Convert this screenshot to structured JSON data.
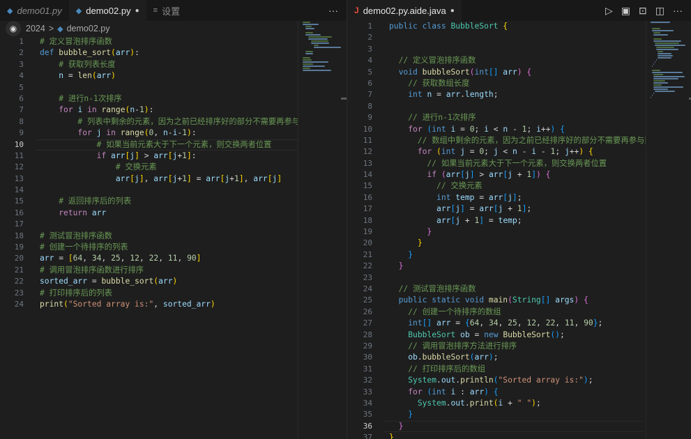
{
  "left": {
    "tabs": [
      {
        "label": "demo01.py",
        "italic": true,
        "active": false,
        "icon": "python-icon"
      },
      {
        "label": "demo02.py",
        "active": true,
        "dirty": true,
        "icon": "python-icon"
      },
      {
        "label": "设置",
        "active": false,
        "icon": "settings-icon"
      }
    ],
    "more_label": "···",
    "breadcrumb": {
      "folder": "2024",
      "separator": ">",
      "file": "demo02.py"
    },
    "current_line": 10,
    "lines": [
      {
        "n": "1",
        "html": "<span class='cm'># 定义冒泡排序函数</span>"
      },
      {
        "n": "2",
        "html": "<span class='k'>def</span> <span class='fn'>bubble_sort</span><span class='br1'>(</span><span class='va'>arr</span><span class='br1'>)</span><span class='pl'>:</span>"
      },
      {
        "n": "3",
        "html": "    <span class='cm'># 获取列表长度</span>"
      },
      {
        "n": "4",
        "html": "    <span class='va'>n</span> <span class='op'>=</span> <span class='fn'>len</span><span class='br1'>(</span><span class='va'>arr</span><span class='br1'>)</span>"
      },
      {
        "n": "5",
        "html": ""
      },
      {
        "n": "6",
        "html": "    <span class='cm'># 进行n-1次排序</span>"
      },
      {
        "n": "7",
        "html": "    <span class='kc'>for</span> <span class='va'>i</span> <span class='kc'>in</span> <span class='fn'>range</span><span class='br1'>(</span><span class='va'>n</span><span class='op'>-</span><span class='nu'>1</span><span class='br1'>)</span><span class='pl'>:</span>"
      },
      {
        "n": "8",
        "html": "        <span class='cm'># 列表中剩余的元素，因为之前已经排序好的部分不需要再参与比较</span>"
      },
      {
        "n": "9",
        "html": "        <span class='kc'>for</span> <span class='va'>j</span> <span class='kc'>in</span> <span class='fn'>range</span><span class='br1'>(</span><span class='nu'>0</span><span class='pl'>,</span> <span class='va'>n</span><span class='op'>-</span><span class='va'>i</span><span class='op'>-</span><span class='nu'>1</span><span class='br1'>)</span><span class='pl'>:</span>"
      },
      {
        "n": "10",
        "html": "            <span class='cm'># 如果当前元素大于下一个元素，则交换两者位置</span>"
      },
      {
        "n": "11",
        "html": "            <span class='kc'>if</span> <span class='va'>arr</span><span class='br1'>[</span><span class='va'>j</span><span class='br1'>]</span> <span class='op'>&gt;</span> <span class='va'>arr</span><span class='br1'>[</span><span class='va'>j</span><span class='op'>+</span><span class='nu'>1</span><span class='br1'>]</span><span class='pl'>:</span>"
      },
      {
        "n": "12",
        "html": "                <span class='cm'># 交换元素</span>"
      },
      {
        "n": "13",
        "html": "                <span class='va'>arr</span><span class='br1'>[</span><span class='va'>j</span><span class='br1'>]</span><span class='pl'>,</span> <span class='va'>arr</span><span class='br1'>[</span><span class='va'>j</span><span class='op'>+</span><span class='nu'>1</span><span class='br1'>]</span> <span class='op'>=</span> <span class='va'>arr</span><span class='br1'>[</span><span class='va'>j</span><span class='op'>+</span><span class='nu'>1</span><span class='br1'>]</span><span class='pl'>,</span> <span class='va'>arr</span><span class='br1'>[</span><span class='va'>j</span><span class='br1'>]</span>"
      },
      {
        "n": "14",
        "html": ""
      },
      {
        "n": "15",
        "html": "    <span class='cm'># 返回排序后的列表</span>"
      },
      {
        "n": "16",
        "html": "    <span class='kc'>return</span> <span class='va'>arr</span>"
      },
      {
        "n": "17",
        "html": ""
      },
      {
        "n": "18",
        "html": "<span class='cm'># 测试冒泡排序函数</span>"
      },
      {
        "n": "19",
        "html": "<span class='cm'># 创建一个待排序的列表</span>"
      },
      {
        "n": "20",
        "html": "<span class='va'>arr</span> <span class='op'>=</span> <span class='br1'>[</span><span class='nu'>64</span><span class='pl'>,</span> <span class='nu'>34</span><span class='pl'>,</span> <span class='nu'>25</span><span class='pl'>,</span> <span class='nu'>12</span><span class='pl'>,</span> <span class='nu'>22</span><span class='pl'>,</span> <span class='nu'>11</span><span class='pl'>,</span> <span class='nu'>90</span><span class='br1'>]</span>"
      },
      {
        "n": "21",
        "html": "<span class='cm'># 调用冒泡排序函数进行排序</span>"
      },
      {
        "n": "22",
        "html": "<span class='va'>sorted_arr</span> <span class='op'>=</span> <span class='fn'>bubble_sort</span><span class='br1'>(</span><span class='va'>arr</span><span class='br1'>)</span>"
      },
      {
        "n": "23",
        "html": "<span class='cm'># 打印排序后的列表</span>"
      },
      {
        "n": "24",
        "html": "<span class='fn'>print</span><span class='br1'>(</span><span class='st'>\"Sorted array is:\"</span><span class='pl'>,</span> <span class='va'>sorted_arr</span><span class='br1'>)</span>"
      }
    ]
  },
  "right": {
    "tabs": [
      {
        "label": "demo02.py.aide.java",
        "active": true,
        "dirty": true,
        "icon": "java-icon"
      }
    ],
    "actions": [
      "run-icon",
      "open-changes-icon",
      "compare-icon",
      "split-editor-icon",
      "more-icon"
    ],
    "current_line": 36,
    "lines": [
      {
        "n": "1",
        "html": "<span class='k'>public</span> <span class='k'>class</span> <span class='ty'>BubbleSort</span> <span class='br1'>{</span>"
      },
      {
        "n": "2",
        "html": ""
      },
      {
        "n": "3",
        "html": ""
      },
      {
        "n": "4",
        "html": "  <span class='cm'>// 定义冒泡排序函数</span>"
      },
      {
        "n": "5",
        "html": "  <span class='k'>void</span> <span class='fn'>bubbleSort</span><span class='br2'>(</span><span class='k'>int</span><span class='br3'>[]</span> <span class='va'>arr</span><span class='br2'>)</span> <span class='br2'>{</span>"
      },
      {
        "n": "6",
        "html": "    <span class='cm'>// 获取数组长度</span>"
      },
      {
        "n": "7",
        "html": "    <span class='k'>int</span> <span class='va'>n</span> <span class='op'>=</span> <span class='va'>arr</span><span class='pl'>.</span><span class='va'>length</span><span class='pl'>;</span>"
      },
      {
        "n": "8",
        "html": ""
      },
      {
        "n": "9",
        "html": "    <span class='cm'>// 进行n-1次排序</span>"
      },
      {
        "n": "10",
        "html": "    <span class='kc'>for</span> <span class='br3'>(</span><span class='k'>int</span> <span class='va'>i</span> <span class='op'>=</span> <span class='nu'>0</span><span class='pl'>;</span> <span class='va'>i</span> <span class='op'>&lt;</span> <span class='va'>n</span> <span class='op'>-</span> <span class='nu'>1</span><span class='pl'>;</span> <span class='va'>i</span><span class='op'>++</span><span class='br3'>)</span> <span class='br3'>{</span>"
      },
      {
        "n": "11",
        "html": "      <span class='cm'>// 数组中剩余的元素，因为之前已经排序好的部分不需要再参与比较</span>"
      },
      {
        "n": "12",
        "html": "      <span class='kc'>for</span> <span class='br1'>(</span><span class='k'>int</span> <span class='va'>j</span> <span class='op'>=</span> <span class='nu'>0</span><span class='pl'>;</span> <span class='va'>j</span> <span class='op'>&lt;</span> <span class='va'>n</span> <span class='op'>-</span> <span class='va'>i</span> <span class='op'>-</span> <span class='nu'>1</span><span class='pl'>;</span> <span class='va'>j</span><span class='op'>++</span><span class='br1'>)</span> <span class='br1'>{</span>"
      },
      {
        "n": "13",
        "html": "        <span class='cm'>// 如果当前元素大于下一个元素，则交换两者位置</span>"
      },
      {
        "n": "14",
        "html": "        <span class='kc'>if</span> <span class='br2'>(</span><span class='va'>arr</span><span class='br3'>[</span><span class='va'>j</span><span class='br3'>]</span> <span class='op'>&gt;</span> <span class='va'>arr</span><span class='br3'>[</span><span class='va'>j</span> <span class='op'>+</span> <span class='nu'>1</span><span class='br3'>]</span><span class='br2'>)</span> <span class='br2'>{</span>"
      },
      {
        "n": "15",
        "html": "          <span class='cm'>// 交换元素</span>"
      },
      {
        "n": "16",
        "html": "          <span class='k'>int</span> <span class='va'>temp</span> <span class='op'>=</span> <span class='va'>arr</span><span class='br3'>[</span><span class='va'>j</span><span class='br3'>]</span><span class='pl'>;</span>"
      },
      {
        "n": "17",
        "html": "          <span class='va'>arr</span><span class='br3'>[</span><span class='va'>j</span><span class='br3'>]</span> <span class='op'>=</span> <span class='va'>arr</span><span class='br3'>[</span><span class='va'>j</span> <span class='op'>+</span> <span class='nu'>1</span><span class='br3'>]</span><span class='pl'>;</span>"
      },
      {
        "n": "18",
        "html": "          <span class='va'>arr</span><span class='br3'>[</span><span class='va'>j</span> <span class='op'>+</span> <span class='nu'>1</span><span class='br3'>]</span> <span class='op'>=</span> <span class='va'>temp</span><span class='pl'>;</span>"
      },
      {
        "n": "19",
        "html": "        <span class='br2'>}</span>"
      },
      {
        "n": "20",
        "html": "      <span class='br1'>}</span>"
      },
      {
        "n": "21",
        "html": "    <span class='br3'>}</span>"
      },
      {
        "n": "22",
        "html": "  <span class='br2'>}</span>"
      },
      {
        "n": "23",
        "html": ""
      },
      {
        "n": "24",
        "html": "  <span class='cm'>// 测试冒泡排序函数</span>"
      },
      {
        "n": "25",
        "html": "  <span class='k'>public</span> <span class='k'>static</span> <span class='k'>void</span> <span class='fn'>main</span><span class='br2'>(</span><span class='ty'>String</span><span class='br3'>[]</span> <span class='va'>args</span><span class='br2'>)</span> <span class='br2'>{</span>"
      },
      {
        "n": "26",
        "html": "    <span class='cm'>// 创建一个待排序的数组</span>"
      },
      {
        "n": "27",
        "html": "    <span class='k'>int</span><span class='br3'>[]</span> <span class='va'>arr</span> <span class='op'>=</span> <span class='br3'>{</span><span class='nu'>64</span><span class='pl'>,</span> <span class='nu'>34</span><span class='pl'>,</span> <span class='nu'>25</span><span class='pl'>,</span> <span class='nu'>12</span><span class='pl'>,</span> <span class='nu'>22</span><span class='pl'>,</span> <span class='nu'>11</span><span class='pl'>,</span> <span class='nu'>90</span><span class='br3'>}</span><span class='pl'>;</span>"
      },
      {
        "n": "28",
        "html": "    <span class='ty'>BubbleSort</span> <span class='va'>ob</span> <span class='op'>=</span> <span class='k'>new</span> <span class='fn'>BubbleSort</span><span class='br3'>()</span><span class='pl'>;</span>"
      },
      {
        "n": "29",
        "html": "    <span class='cm'>// 调用冒泡排序方法进行排序</span>"
      },
      {
        "n": "30",
        "html": "    <span class='va'>ob</span><span class='pl'>.</span><span class='fn'>bubbleSort</span><span class='br3'>(</span><span class='va'>arr</span><span class='br3'>)</span><span class='pl'>;</span>"
      },
      {
        "n": "31",
        "html": "    <span class='cm'>// 打印排序后的数组</span>"
      },
      {
        "n": "32",
        "html": "    <span class='ty'>System</span><span class='pl'>.</span><span class='va'>out</span><span class='pl'>.</span><span class='fn'>println</span><span class='br3'>(</span><span class='st'>\"Sorted array is:\"</span><span class='br3'>)</span><span class='pl'>;</span>"
      },
      {
        "n": "33",
        "html": "    <span class='kc'>for</span> <span class='br3'>(</span><span class='k'>int</span> <span class='va'>i</span> <span class='pl'>:</span> <span class='va'>arr</span><span class='br3'>)</span> <span class='br3'>{</span>"
      },
      {
        "n": "34",
        "html": "      <span class='ty'>System</span><span class='pl'>.</span><span class='va'>out</span><span class='pl'>.</span><span class='fn'>print</span><span class='br1'>(</span><span class='va'>i</span> <span class='op'>+</span> <span class='st'>\" \"</span><span class='br1'>)</span><span class='pl'>;</span>"
      },
      {
        "n": "35",
        "html": "    <span class='br3'>}</span>"
      },
      {
        "n": "36",
        "html": "  <span class='br2'>}</span>"
      },
      {
        "n": "37",
        "html": "<span class='br1'>}</span>"
      }
    ]
  }
}
